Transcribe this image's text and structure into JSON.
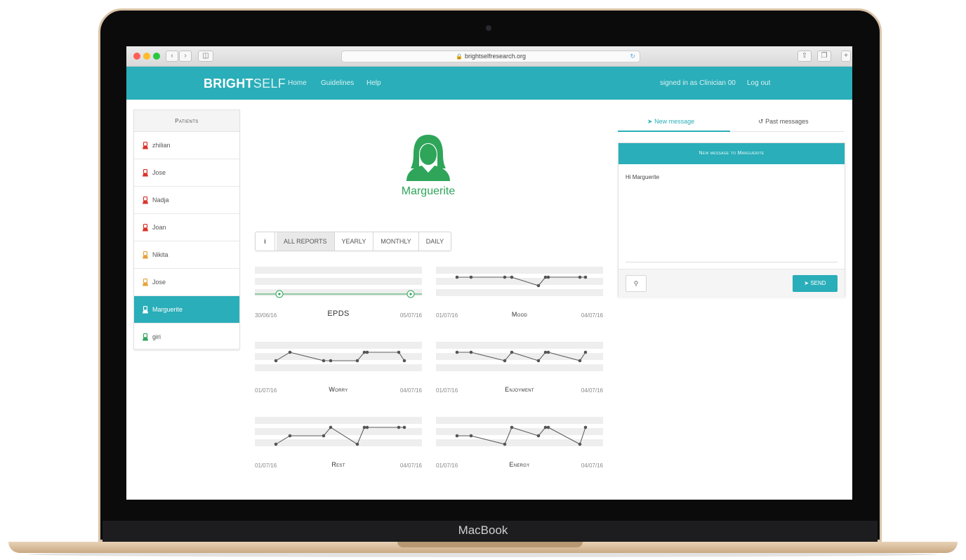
{
  "device": {
    "brand_label": "MacBook"
  },
  "browser": {
    "url": "brightselfresearch.org"
  },
  "app": {
    "logo_bold": "BRIGHT",
    "logo_light": "SELF",
    "nav": [
      "Home",
      "Guidelines",
      "Help"
    ],
    "signed_in": "signed in as Clinician 00",
    "logout": "Log out",
    "accent": "#2aaeb9"
  },
  "patients": {
    "header": "Patients",
    "list": [
      {
        "name": "zhilian",
        "status_color": "#d9342b"
      },
      {
        "name": "Jose",
        "status_color": "#d9342b"
      },
      {
        "name": "Nadja",
        "status_color": "#d9342b"
      },
      {
        "name": "Joan",
        "status_color": "#d9342b"
      },
      {
        "name": "Nikita",
        "status_color": "#e6a23c"
      },
      {
        "name": "Jose",
        "status_color": "#e6a23c"
      },
      {
        "name": "Marguerite",
        "status_color": "#ffffff",
        "active": true
      },
      {
        "name": "giri",
        "status_color": "#2fa55a"
      }
    ]
  },
  "selected_patient": {
    "name": "Marguerite",
    "avatar_color": "#2fa55a"
  },
  "report_tabs": {
    "info": "i",
    "items": [
      "ALL REPORTS",
      "YEARLY",
      "MONTHLY",
      "DAILY"
    ],
    "selected": "ALL REPORTS"
  },
  "chart_data": [
    {
      "type": "line",
      "title": "EPDS",
      "x_start": "30/06/16",
      "x_end": "05/07/16",
      "values": [
        1,
        1
      ]
    },
    {
      "type": "line",
      "title": "Mood",
      "x_start": "01/07/16",
      "x_end": "04/07/16",
      "values": [
        3,
        3,
        3,
        3,
        2,
        3,
        3,
        3,
        3
      ]
    },
    {
      "type": "line",
      "title": "Worry",
      "x_start": "01/07/16",
      "x_end": "04/07/16",
      "values": [
        2,
        3,
        2,
        2,
        2,
        3,
        3,
        3,
        2
      ]
    },
    {
      "type": "line",
      "title": "Enjoyment",
      "x_start": "01/07/16",
      "x_end": "04/07/16",
      "values": [
        3,
        3,
        2,
        3,
        2,
        3,
        3,
        2,
        3
      ]
    },
    {
      "type": "line",
      "title": "Rest",
      "x_start": "01/07/16",
      "x_end": "04/07/16",
      "values": [
        1,
        2,
        2,
        3,
        1,
        3,
        3,
        3,
        3
      ]
    },
    {
      "type": "line",
      "title": "Energy",
      "x_start": "01/07/16",
      "x_end": "04/07/16",
      "values": [
        2,
        2,
        1,
        3,
        2,
        3,
        3,
        1,
        3
      ]
    }
  ],
  "messages": {
    "tab_new": "New message",
    "tab_past": "Past messages",
    "panel_title": "New message to Marguerite",
    "body": "Hi Marguerite",
    "send": "SEND"
  }
}
